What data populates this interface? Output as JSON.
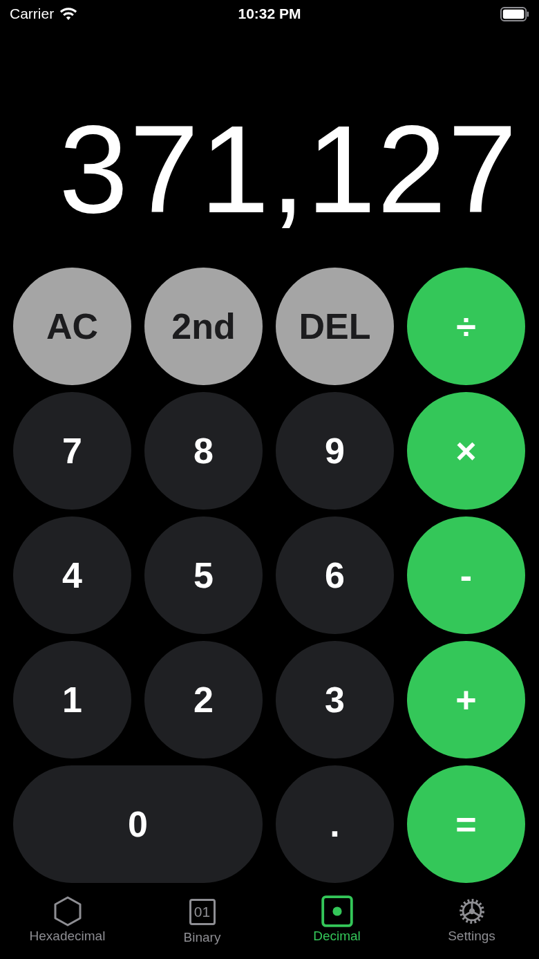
{
  "status_bar": {
    "carrier": "Carrier",
    "time": "10:32 PM"
  },
  "display": {
    "value": "371,127"
  },
  "keys": [
    {
      "label": "AC",
      "kind": "function"
    },
    {
      "label": "2nd",
      "kind": "function"
    },
    {
      "label": "DEL",
      "kind": "function"
    },
    {
      "label": "÷",
      "kind": "operator"
    },
    {
      "label": "7",
      "kind": "digit"
    },
    {
      "label": "8",
      "kind": "digit"
    },
    {
      "label": "9",
      "kind": "digit"
    },
    {
      "label": "×",
      "kind": "operator"
    },
    {
      "label": "4",
      "kind": "digit"
    },
    {
      "label": "5",
      "kind": "digit"
    },
    {
      "label": "6",
      "kind": "digit"
    },
    {
      "label": "-",
      "kind": "operator"
    },
    {
      "label": "1",
      "kind": "digit"
    },
    {
      "label": "2",
      "kind": "digit"
    },
    {
      "label": "3",
      "kind": "digit"
    },
    {
      "label": "+",
      "kind": "operator"
    },
    {
      "label": "0",
      "kind": "wide"
    },
    {
      "label": ".",
      "kind": "digit"
    },
    {
      "label": "=",
      "kind": "operator"
    }
  ],
  "tabs": [
    {
      "label": "Hexadecimal",
      "kind": "hexagon",
      "selected": false
    },
    {
      "label": "Binary",
      "kind": "binary",
      "icon_text": "01",
      "selected": false
    },
    {
      "label": "Decimal",
      "kind": "dot",
      "selected": true
    },
    {
      "label": "Settings",
      "kind": "gear",
      "selected": false
    }
  ]
}
